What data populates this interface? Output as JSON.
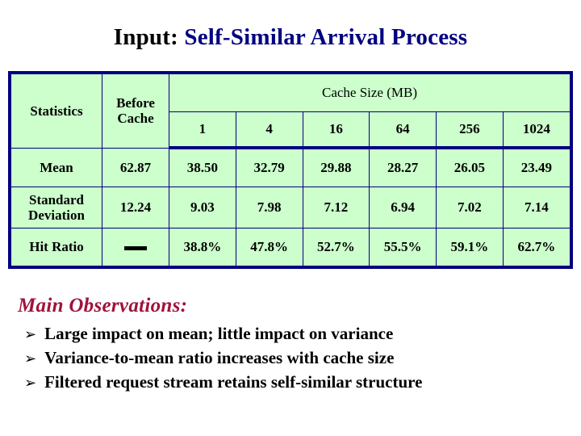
{
  "slide": {
    "title_lead": "Input:",
    "title_main": "Self-Similar Arrival Process"
  },
  "table": {
    "col_stat_header": "Statistics",
    "col_before_header": "Before Cache",
    "group_header": "Cache Size (MB)",
    "cache_sizes": [
      "1",
      "4",
      "16",
      "64",
      "256",
      "1024"
    ],
    "rows": [
      {
        "label": "Mean",
        "before": "62.87",
        "values": [
          "38.50",
          "32.79",
          "29.88",
          "28.27",
          "26.05",
          "23.49"
        ]
      },
      {
        "label": "Standard Deviation",
        "before": "12.24",
        "values": [
          "9.03",
          "7.98",
          "7.12",
          "6.94",
          "7.02",
          "7.14"
        ]
      },
      {
        "label": "Hit Ratio",
        "before": "—",
        "values": [
          "38.8%",
          "47.8%",
          "52.7%",
          "55.5%",
          "59.1%",
          "62.7%"
        ]
      }
    ]
  },
  "observations": {
    "heading": "Main Observations:",
    "bullet_glyph": "➢",
    "items": [
      "Large impact on mean; little impact on variance",
      "Variance-to-mean ratio increases with cache size",
      "Filtered request stream retains self-similar structure"
    ]
  },
  "colors": {
    "title_accent": "#000080",
    "table_fill": "#ccffcc",
    "table_border": "#000080",
    "observations_heading": "#a0123c"
  }
}
